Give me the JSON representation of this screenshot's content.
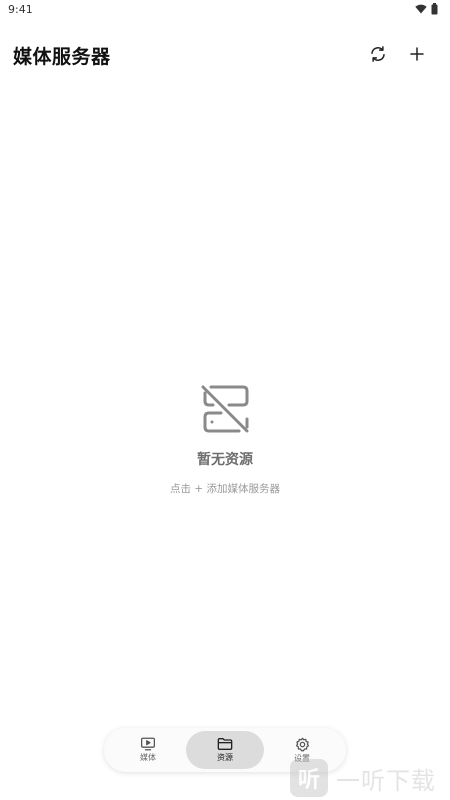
{
  "status_bar": {
    "time": "9:41",
    "icons": [
      "wifi-icon",
      "battery-icon"
    ]
  },
  "header": {
    "title": "媒体服务器",
    "actions": [
      {
        "name": "refresh",
        "icon": "refresh-icon"
      },
      {
        "name": "add",
        "icon": "plus-icon"
      }
    ]
  },
  "empty_state": {
    "icon": "server-off-icon",
    "title": "暂无资源",
    "hint": "点击 + 添加媒体服务器"
  },
  "bottom_nav": {
    "items": [
      {
        "label": "媒体",
        "icon": "tv-play-icon",
        "active": false
      },
      {
        "label": "资源",
        "icon": "folder-icon",
        "active": true
      },
      {
        "label": "设置",
        "icon": "gear-icon",
        "active": false
      }
    ]
  },
  "watermark": {
    "badge": "听",
    "text": "一听下载"
  },
  "colors": {
    "active_nav_bg": "#dcdcdc",
    "muted_text": "#9a9a9a"
  }
}
